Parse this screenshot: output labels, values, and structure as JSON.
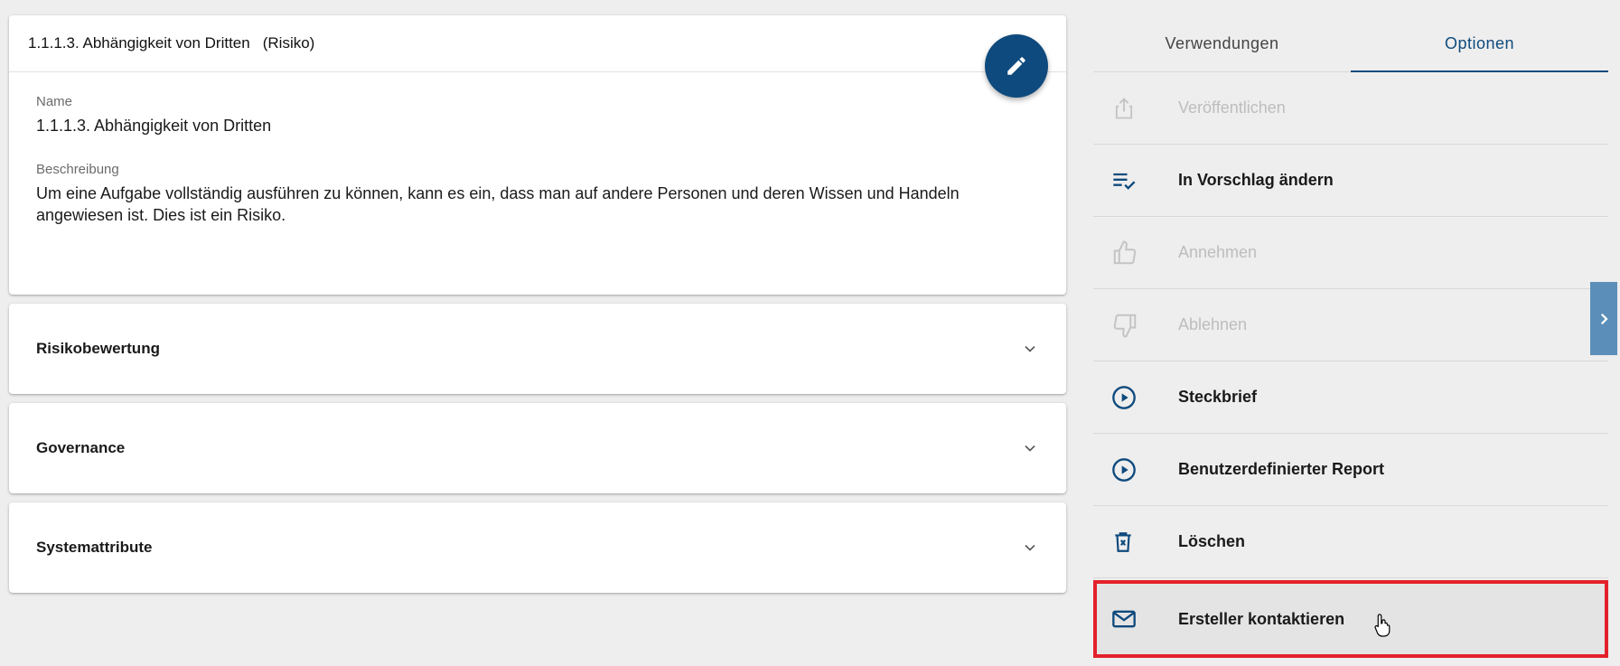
{
  "detail": {
    "header_title": "1.1.1.3. Abhängigkeit von Dritten",
    "header_type": "(Risiko)",
    "edit_icon": "pencil-icon",
    "name_label": "Name",
    "name_value": "1.1.1.3. Abhängigkeit von Dritten",
    "description_label": "Beschreibung",
    "description_value": "Um eine Aufgabe vollständig ausführen zu können, kann es ein, dass man auf andere Personen und deren Wissen und Handeln angewiesen ist. Dies ist ein Risiko."
  },
  "panels": [
    {
      "label": "Risikobewertung",
      "icon": "chevron-down-icon"
    },
    {
      "label": "Governance",
      "icon": "chevron-down-icon"
    },
    {
      "label": "Systemattribute",
      "icon": "chevron-down-icon"
    }
  ],
  "tabs": [
    {
      "label": "Verwendungen",
      "active": false
    },
    {
      "label": "Optionen",
      "active": true
    }
  ],
  "options": [
    {
      "label": "Veröffentlichen",
      "icon": "share-icon",
      "enabled": false
    },
    {
      "label": "In Vorschlag ändern",
      "icon": "list-check-icon",
      "enabled": true
    },
    {
      "label": "Annehmen",
      "icon": "thumbs-up-icon",
      "enabled": false
    },
    {
      "label": "Ablehnen",
      "icon": "thumbs-down-icon",
      "enabled": false
    },
    {
      "label": "Steckbrief",
      "icon": "play-circle-icon",
      "enabled": true
    },
    {
      "label": "Benutzerdefinierter Report",
      "icon": "play-circle-icon",
      "enabled": true
    },
    {
      "label": "Löschen",
      "icon": "trash-icon",
      "enabled": true
    },
    {
      "label": "Ersteller kontaktieren",
      "icon": "mail-icon",
      "enabled": true,
      "highlighted": true
    }
  ],
  "colors": {
    "accent": "#0e4a7d",
    "highlight_border": "#e3212b",
    "side_toggle": "#5b8fb9",
    "background": "#eeeeee"
  }
}
